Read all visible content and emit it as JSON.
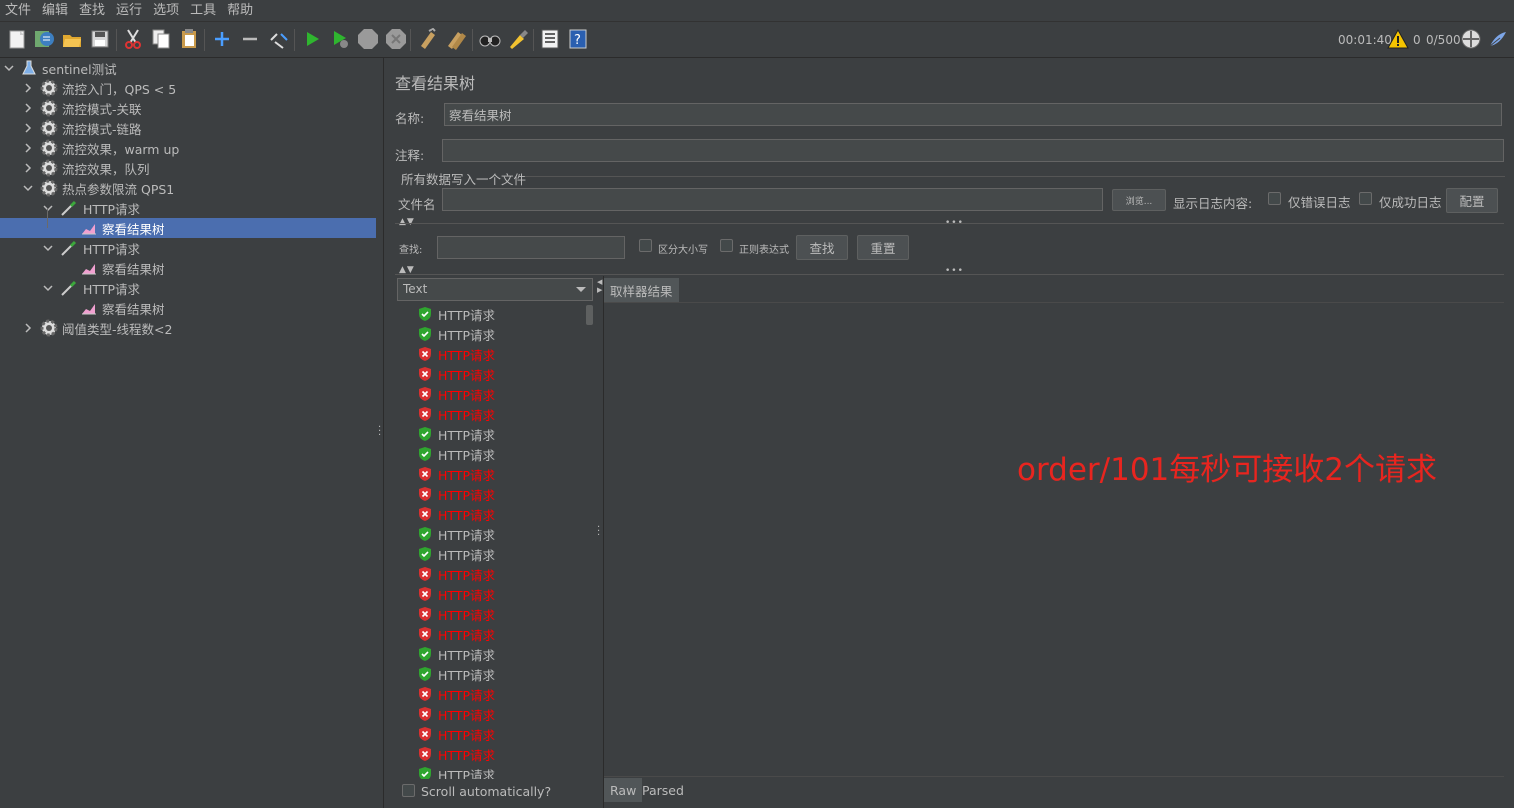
{
  "menu": [
    "文件",
    "编辑",
    "查找",
    "运行",
    "选项",
    "工具",
    "帮助"
  ],
  "toolbar": {
    "icons": [
      "new-icon",
      "templates-icon",
      "open-icon",
      "save-icon",
      "cut-icon",
      "copy-icon",
      "paste-icon",
      "expand-icon",
      "collapse-icon",
      "toggle-icon",
      "start-icon",
      "start-no-pause-icon",
      "stop-icon",
      "shutdown-icon",
      "clear-icon",
      "clear-all-icon",
      "search-icon",
      "reset-search-icon",
      "function-helper-icon",
      "help-icon"
    ],
    "elapsed": "00:01:40",
    "warnings": "0",
    "threads": "0/500"
  },
  "tree": {
    "root": "sentinel测试",
    "items": [
      {
        "label": "流控入门，QPS < 5"
      },
      {
        "label": "流控模式-关联"
      },
      {
        "label": "流控模式-链路"
      },
      {
        "label": "流控效果，warm up"
      },
      {
        "label": "流控效果，队列"
      },
      {
        "label": "热点参数限流 QPS1"
      },
      {
        "label": "HTTP请求"
      },
      {
        "label": "察看结果树"
      },
      {
        "label": "HTTP请求"
      },
      {
        "label": "察看结果树"
      },
      {
        "label": "HTTP请求"
      },
      {
        "label": "察看结果树"
      },
      {
        "label": "阈值类型-线程数<2"
      }
    ]
  },
  "panel": {
    "title": "查看结果树",
    "name_label": "名称:",
    "name_value": "察看结果树",
    "comment_label": "注释:",
    "comment_value": "",
    "section_title": "所有数据写入一个文件",
    "filename_label": "文件名",
    "filename_value": "",
    "browse_label": "浏览...",
    "log_label": "显示日志内容:",
    "errors_only_label": "仅错误日志",
    "success_only_label": "仅成功日志",
    "configure_label": "配置",
    "search_label": "查找:",
    "case_label": "区分大小写",
    "regex_label": "正则表达式",
    "find_button": "查找",
    "reset_button": "重置",
    "renderer": "Text",
    "scroll_auto_label": "Scroll automatically?",
    "tab_sampler": "取样器结果",
    "tab_raw": "Raw",
    "tab_parsed": "Parsed",
    "annotation": "order/101每秒可接收2个请求"
  },
  "results": [
    {
      "label": "HTTP请求",
      "status": "ok"
    },
    {
      "label": "HTTP请求",
      "status": "ok"
    },
    {
      "label": "HTTP请求",
      "status": "err"
    },
    {
      "label": "HTTP请求",
      "status": "err"
    },
    {
      "label": "HTTP请求",
      "status": "err"
    },
    {
      "label": "HTTP请求",
      "status": "err"
    },
    {
      "label": "HTTP请求",
      "status": "ok"
    },
    {
      "label": "HTTP请求",
      "status": "ok"
    },
    {
      "label": "HTTP请求",
      "status": "err"
    },
    {
      "label": "HTTP请求",
      "status": "err"
    },
    {
      "label": "HTTP请求",
      "status": "err"
    },
    {
      "label": "HTTP请求",
      "status": "ok"
    },
    {
      "label": "HTTP请求",
      "status": "ok"
    },
    {
      "label": "HTTP请求",
      "status": "err"
    },
    {
      "label": "HTTP请求",
      "status": "err"
    },
    {
      "label": "HTTP请求",
      "status": "err"
    },
    {
      "label": "HTTP请求",
      "status": "err"
    },
    {
      "label": "HTTP请求",
      "status": "ok"
    },
    {
      "label": "HTTP请求",
      "status": "ok"
    },
    {
      "label": "HTTP请求",
      "status": "err"
    },
    {
      "label": "HTTP请求",
      "status": "err"
    },
    {
      "label": "HTTP请求",
      "status": "err"
    },
    {
      "label": "HTTP请求",
      "status": "err"
    },
    {
      "label": "HTTP请求",
      "status": "ok"
    }
  ],
  "colors": {
    "error_text": "#ff0000",
    "ok_icon": "#2fa52f",
    "err_icon": "#d93030",
    "annotation": "#e8251f",
    "selection": "#4b6eaf"
  }
}
